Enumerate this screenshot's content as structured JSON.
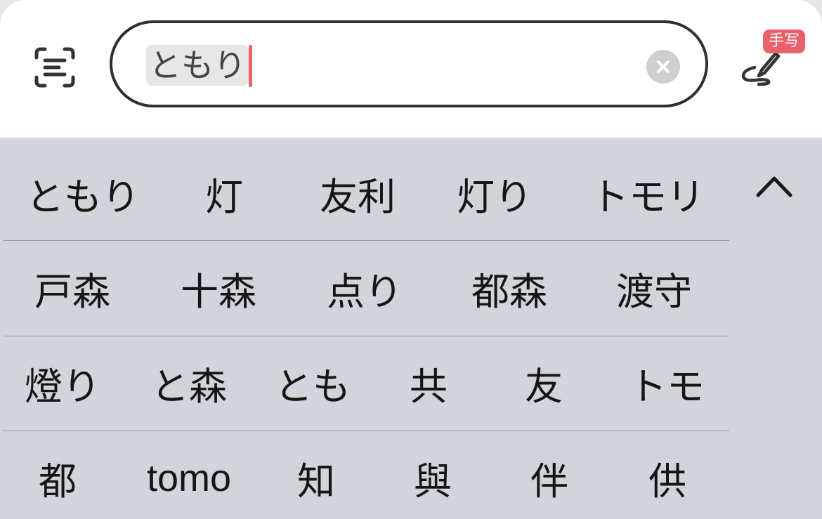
{
  "header": {
    "scan_icon": "scan-text-icon",
    "search": {
      "composing_text": "ともり",
      "clear_icon": "clear-x-icon"
    },
    "handwrite": {
      "badge_label": "手写",
      "icon": "handwriting-pen-icon"
    }
  },
  "candidates": {
    "rows": [
      [
        "ともり",
        "灯",
        "友利",
        "灯り",
        "トモリ"
      ],
      [
        "戸森",
        "十森",
        "点り",
        "都森",
        "渡守"
      ],
      [
        "燈り",
        "と森",
        "とも",
        "共",
        "友",
        "トモ"
      ],
      [
        "都",
        "tomo",
        "知",
        "與",
        "伴",
        "供"
      ]
    ],
    "collapse_icon": "chevron-up-icon"
  },
  "colors": {
    "accent": "#e8616b",
    "panel_bg": "#d1d4da",
    "header_bg": "#ffffff",
    "border": "#2f2f2f"
  }
}
